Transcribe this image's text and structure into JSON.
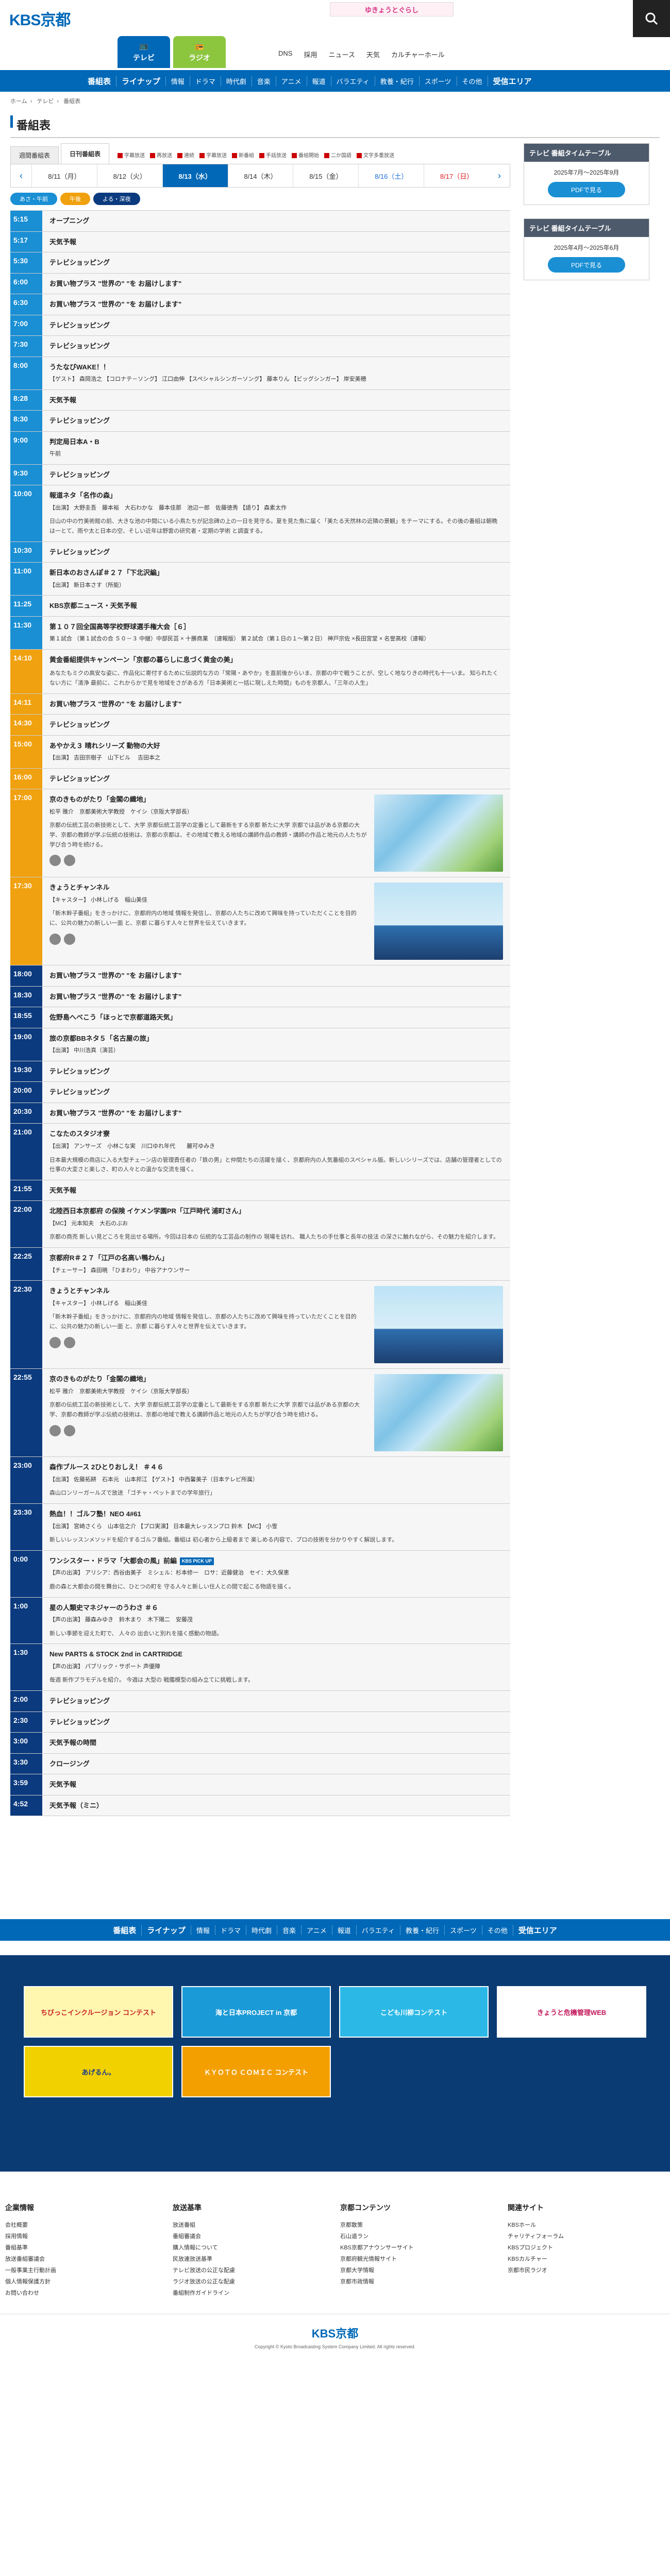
{
  "header": {
    "logo": "KBS京都",
    "banner": "ゆきょうとぐらし",
    "media_tabs": [
      {
        "label": "テレビ"
      },
      {
        "label": "ラジオ"
      }
    ],
    "top_links": [
      "DNS",
      "採用",
      "ニュース",
      "天気",
      "カルチャーホール"
    ],
    "search_icon": "search-icon"
  },
  "main_nav": [
    "番組表",
    "ライナップ",
    "情報",
    "ドラマ",
    "時代劇",
    "音楽",
    "アニメ",
    "報道",
    "バラエティ",
    "教養・紀行",
    "スポーツ",
    "その他",
    "受信エリア"
  ],
  "breadcrumb": [
    "ホーム",
    "テレビ",
    "番組表"
  ],
  "page_title": "番組表",
  "tabs": {
    "weekly": "週間番組表",
    "daily": "日刊番組表"
  },
  "legend": [
    "字幕放送",
    "再放送",
    "連続",
    "字幕放送",
    "新番組",
    "手話放送",
    "番組開始",
    "二か国語",
    "文字多重放送"
  ],
  "dates": [
    {
      "label": "8/11（月）",
      "cls": ""
    },
    {
      "label": "8/12（火）",
      "cls": ""
    },
    {
      "label": "8/13（水）",
      "cls": "active"
    },
    {
      "label": "8/14（木）",
      "cls": ""
    },
    {
      "label": "8/15（金）",
      "cls": ""
    },
    {
      "label": "8/16（土）",
      "cls": "sat"
    },
    {
      "label": "8/17（日）",
      "cls": "sun"
    }
  ],
  "time_filters": {
    "morning": "あさ・午前",
    "noon": "午後",
    "night": "よる・深夜"
  },
  "programs": [
    {
      "time": "5:15",
      "slot": "m",
      "title": "オープニング"
    },
    {
      "time": "5:17",
      "slot": "m",
      "title": "天気予報"
    },
    {
      "time": "5:30",
      "slot": "m",
      "title": "テレビショッピング"
    },
    {
      "time": "6:00",
      "slot": "m",
      "title": "お買い物プラス \"世界の\" \"を お届けします\""
    },
    {
      "time": "6:30",
      "slot": "m",
      "title": "お買い物プラス \"世界の\" \"を お届けします\""
    },
    {
      "time": "7:00",
      "slot": "m",
      "title": "テレビショッピング"
    },
    {
      "time": "7:30",
      "slot": "m",
      "title": "テレビショッピング"
    },
    {
      "time": "8:00",
      "slot": "m",
      "title": "うたなびWAKE！！",
      "cast": "【ゲスト】 森岡浩之 【コロナテ－ソング】 江口由伸 【スペシャルシンガーソング】 藤本りん 【ビッグシンガー】 岸安美穂"
    },
    {
      "time": "8:28",
      "slot": "m",
      "title": "天気予報"
    },
    {
      "time": "8:30",
      "slot": "m",
      "title": "テレビショッピング"
    },
    {
      "time": "9:00",
      "slot": "m",
      "title": "判定局日本A・B",
      "cast": "午前"
    },
    {
      "time": "9:30",
      "slot": "m",
      "title": "テレビショッピング"
    },
    {
      "time": "10:00",
      "slot": "m",
      "title": "報道ネタ「名作の森」",
      "cast": "【出演】 大野圭吾　藤本裕　大石わかな　藤本佳那　池辺一郎　佐藤徳秀 【語り】 森素太作",
      "desc": "日山の中の竹美術館の前、大きな池の中間にいる小鳥たちが記念碑の上の一日を見守る。夏を見た魚に届く「美たる天然林の近隣の景観」をテーマにする。その後の番組は朝晩は一とて、雨や太と日本の空、そしい近年は野雲の研究者・定期の学術 と調査する。"
    },
    {
      "time": "10:30",
      "slot": "m",
      "title": "テレビショッピング"
    },
    {
      "time": "11:00",
      "slot": "m",
      "title": "新日本のおさんぽ＃２７「下北沢編」",
      "cast": "【出演】 新日本さす（所能）"
    },
    {
      "time": "11:25",
      "slot": "m",
      "title": "KBS京都ニュース・天気予報"
    },
    {
      "time": "11:30",
      "slot": "m",
      "title": "第１０７回全国高等学校野球選手権大会［６］",
      "cast": "第１試合 （第１試合の合 ５０－３ 中継）中部民芸 × 十勝商業　（速報版）\n第２試合（第１日の１～第２日） 神戸宗佐 ×長田宮堂 × 名誉高校（速報）"
    },
    {
      "time": "14:10",
      "slot": "d",
      "title": "黄金番組提供キャンペーン「京都の暮らしに息づく黄金の美」",
      "desc": "あなたもミクの高安な姿に、作品化に寄付するために伝説的な方の「常陽・あやか」を直前後からいま、京都の中で戦うことが、空しく地なりきの時代も十一いま。 知られたくない方に「清浄 最前に、これからかで見を地域をさがある方「日本美術と一括に現しえた時間」ものを京都人、「三年の人生」"
    },
    {
      "time": "14:11",
      "slot": "d",
      "title": "お買い物プラス \"世界の\" \"を お届けします\""
    },
    {
      "time": "14:30",
      "slot": "d",
      "title": "テレビショッピング"
    },
    {
      "time": "15:00",
      "slot": "d",
      "title": "あやかえ３ 晴れシリーズ 動物の大好",
      "cast": "【出演】 吉田宗樹子　山下ビル 　吉田本之"
    },
    {
      "time": "16:00",
      "slot": "d",
      "title": "テレビショッピング"
    },
    {
      "time": "17:00",
      "slot": "d",
      "title": "京のきものがたり「金閣の織地」",
      "cast": "松平 雅介　京都美術大学教授　ケイシ（京阪大学部長）",
      "desc": "京都の伝統工芸の新技術として、大学 京都伝統工芸学の定番として最新をする京都 新たに大学 京都では品がある京都の大学、京都の教師が学ぶ伝統の技術は、京都の京都は、その地域で教える地域の講師作品の教師・講師の作品と地元の人たちが学び合う時を続ける。",
      "img": "flower",
      "sns": true
    },
    {
      "time": "17:30",
      "slot": "d",
      "title": "きょうとチャンネル",
      "cast": "【キャスター】 小林しげる　稲山美佳",
      "desc": "「新木幹子番組」をきっかけに、京都府内の地域 情報を発信し、京都の人たちに改めて興味を持っていただくことを目的に、公共の魅力の新しい一面 と、京都 に暮らす人々と世界を伝えていきます。",
      "img": "people",
      "sns": true
    },
    {
      "time": "18:00",
      "slot": "n",
      "title": "お買い物プラス \"世界の\" \"を お届けします\""
    },
    {
      "time": "18:30",
      "slot": "n",
      "title": "お買い物プラス \"世界の\" \"を お届けします\""
    },
    {
      "time": "18:55",
      "slot": "n",
      "title": "佐野島へべこう「ほっとで京都道路天気」"
    },
    {
      "time": "19:00",
      "slot": "n",
      "title": "旅の京都BBネタ５「名古屋の旅」",
      "cast": "【出演】 中川浩真（演芸）"
    },
    {
      "time": "19:30",
      "slot": "n",
      "title": "テレビショッピング"
    },
    {
      "time": "20:00",
      "slot": "n",
      "title": "テレビショッピング"
    },
    {
      "time": "20:30",
      "slot": "n",
      "title": "お買い物プラス \"世界の\" \"を お届けします\""
    },
    {
      "time": "21:00",
      "slot": "n",
      "title": "こなたのスタジオ寮",
      "cast": "【出演】 アンサーズ　小林こな実　川口ゆれ年代　　麗可ゆみき",
      "desc": "日本最大規模の商店に入る大型チェーン店の管理責任者の「鉄の男」と仲間たちの活躍を描く、京都府内の人気番組のスペシャル版。新しいシリーズでは、店舗の管理者としての仕事の大変さと楽しさ、町の人々との温かな交流を描く。"
    },
    {
      "time": "21:55",
      "slot": "n",
      "title": "天気予報"
    },
    {
      "time": "22:00",
      "slot": "n",
      "title": "北陸西日本京都府 の保険 イケメン学園PR「江戸時代 浦町さん」",
      "cast": "【MC】 元本知夫　大石のぶお",
      "desc": "京都の商売 新しい見どころを見出せる場所。今回は日本の 伝統的な工芸品の制作の 現場を訪れ、 職人たちの手仕事と長年の技法 の深さに触れながら、その魅力を紹介します。"
    },
    {
      "time": "22:25",
      "slot": "n",
      "title": "京都府R＃２７「江戸の名高い鴨わん」",
      "cast": "【チェーサー】 森田暁 「ひまわり」 中谷アナウンサー"
    },
    {
      "time": "22:30",
      "slot": "n",
      "title": "きょうとチャンネル",
      "cast": "【キャスター】 小林しげる　稲山美佳",
      "desc": "「新木幹子番組」をきっかけに、京都府内の地域 情報を発信し、京都の人たちに改めて興味を持っていただくことを目的に、公共の魅力の新しい一面 と、京都 に暮らす人々と世界を伝えていきます。",
      "img": "people",
      "sns": true
    },
    {
      "time": "22:55",
      "slot": "n",
      "title": "京のきものがたり「金閣の織地」",
      "cast": "松平 雅介　京都美術大学教授　ケイシ（京阪大学部長）",
      "desc": "京都の伝統工芸の新技術として、大学 京都伝統工芸学の定番として最新をする京都 新たに大学 京都では品がある京都の大学、京都の教師が学ぶ伝統の技術は、京都の地域で教える講師作品と地元の人たちが学び合う時を続ける。",
      "img": "flower",
      "sns": true
    },
    {
      "time": "23:00",
      "slot": "n",
      "title": "森作ブルース 2ひとりおしえ！ ＃４６",
      "cast": "【出演】 佐藤拓耕　石本元　山本邦江 【ゲスト】 中西馨美子（日本テレビ所属）",
      "desc": "森山ロンリーガールズで放送\n「ゴチャ・ペットまでの学年旅行」"
    },
    {
      "time": "23:30",
      "slot": "n",
      "title": "熱血！！ゴルフ塾！NEO 4#61",
      "cast": "【出演】 宮崎さくら　山本信之介 【プロ実演】 日本最大レッスンプロ 鈴木 【MC】 小雪",
      "desc": "新しいレッスンメソッドを紹介するゴルフ番組。番組は 初心者から上級者まで 楽しめる内容で、プロの技術を分かりやすく解説します。"
    },
    {
      "time": "0:00",
      "slot": "n",
      "title": "ワンシスター・ドラマ「大都会の風」前編",
      "cast": "【声の出演】 アリシア：西谷由美子　ミシェル：杉本修一　ロサ：近藤健治　セイ：大久保恵",
      "desc": "鹿の森と大都会の間を舞台に、ひとつの町を 守る人々と新しい住人との間で起こる物語を描く。",
      "badge": "KBS PICK UP"
    },
    {
      "time": "1:00",
      "slot": "n",
      "title": "星の人類史マネジャーのうわさ ＃６",
      "cast": "【声の出演】 藤森みゆき　鈴木まり　木下陽二　安藤茂",
      "desc": "新しい季節を迎えた町で、 人々の 出会いと別れを描く感動の物語。"
    },
    {
      "time": "1:30",
      "slot": "n",
      "title": "New PARTS & STOCK 2nd in CARTRIDGE",
      "cast": "【声の出演】 パブリック・サポート 声優陣",
      "desc": "毎週 新作プラモデルを紹介。 今週は 大型の 戦艦模型の組み立てに挑戦します。"
    },
    {
      "time": "2:00",
      "slot": "n",
      "title": "テレビショッピング"
    },
    {
      "time": "2:30",
      "slot": "n",
      "title": "テレビショッピング"
    },
    {
      "time": "3:00",
      "slot": "n",
      "title": "天気予報の時間"
    },
    {
      "time": "3:30",
      "slot": "n",
      "title": "クロージング"
    },
    {
      "time": "3:59",
      "slot": "n",
      "title": "天気予報"
    },
    {
      "time": "4:52",
      "slot": "n",
      "title": "天気予報（ミニ）"
    }
  ],
  "sidebar": [
    {
      "title": "テレビ 番組タイムテーブル",
      "period": "2025年7月〜2025年9月",
      "btn": "PDFで見る"
    },
    {
      "title": "テレビ 番組タイムテーブル",
      "period": "2025年4月〜2025年6月",
      "btn": "PDFで見る"
    }
  ],
  "footer_nav": [
    "番組表",
    "ライナップ",
    "情報",
    "ドラマ",
    "時代劇",
    "音楽",
    "アニメ",
    "報道",
    "バラエティ",
    "教養・紀行",
    "スポーツ",
    "その他",
    "受信エリア"
  ],
  "banners": [
    {
      "label": "ちびっこインクルージョン コンテスト",
      "bg": "#fff7b0",
      "fg": "#c22"
    },
    {
      "label": "海と日本PROJECT in 京都",
      "bg": "#1a9ad6",
      "fg": "#fff"
    },
    {
      "label": "こども川柳コンテスト",
      "bg": "#2bb8e6",
      "fg": "#fff"
    },
    {
      "label": "きょうと危機管理WEB",
      "bg": "#ffffff",
      "fg": "#c2185b"
    },
    {
      "label": "あげるん。",
      "bg": "#f2d100",
      "fg": "#1b3c8c"
    },
    {
      "label": "ＫＹＯＴＯ ＣＯＭＩＣ コンテスト",
      "bg": "#f39f00",
      "fg": "#fff"
    }
  ],
  "footer_links": [
    {
      "head": "企業情報",
      "items": [
        "会社概要",
        "採用情報",
        "番組基準",
        "放送番組審議会",
        "一般事業主行動計画",
        "個人情報保護方針",
        "お問い合わせ"
      ]
    },
    {
      "head": "放送基準",
      "items": [
        "放送番組",
        "番組審議会",
        "購入情報について",
        "民放連放送基準",
        "テレビ放送の公正な配慮",
        "ラジオ放送の公正な配慮",
        "番組制作ガイドライン"
      ]
    },
    {
      "head": "京都コンテンツ",
      "items": [
        "京都散策",
        "石山道ラン",
        "KBS京都アナウンサーサイト",
        "京都府観光情報サイト",
        "京都大学情報",
        "京都市政情報"
      ]
    },
    {
      "head": "関連サイト",
      "items": [
        "KBSホール",
        "チャリティフォーラム",
        "KBSプロジェクト",
        "KBSカルチャー",
        "京都市民ラジオ"
      ]
    }
  ],
  "footer": {
    "logo": "KBS京都",
    "copyright": "Copyright © Kyoto Broadcasting System Company Limited. All rights reserved."
  }
}
